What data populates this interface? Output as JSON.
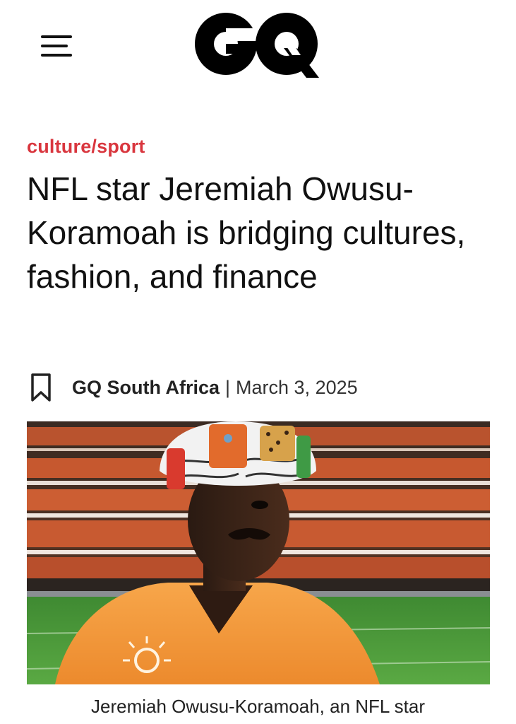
{
  "header": {
    "menu_icon": "hamburger-menu-icon",
    "logo_text": "GQ"
  },
  "article": {
    "category": "culture/sport",
    "title": "NFL star Jeremiah Owusu-Koramoah is bridging cultures, fashion, and finance",
    "bookmark_icon": "bookmark-icon",
    "source": "GQ South Africa",
    "separator": "|",
    "date": "March 3, 2025",
    "caption": "Jeremiah Owusu-Koramoah, an NFL star"
  },
  "colors": {
    "category": "#d9363e",
    "text": "#111111",
    "background": "#ffffff",
    "robe": "#f39a3d",
    "stadium_seats": "#c5532c",
    "field": "#4f9d3b"
  }
}
